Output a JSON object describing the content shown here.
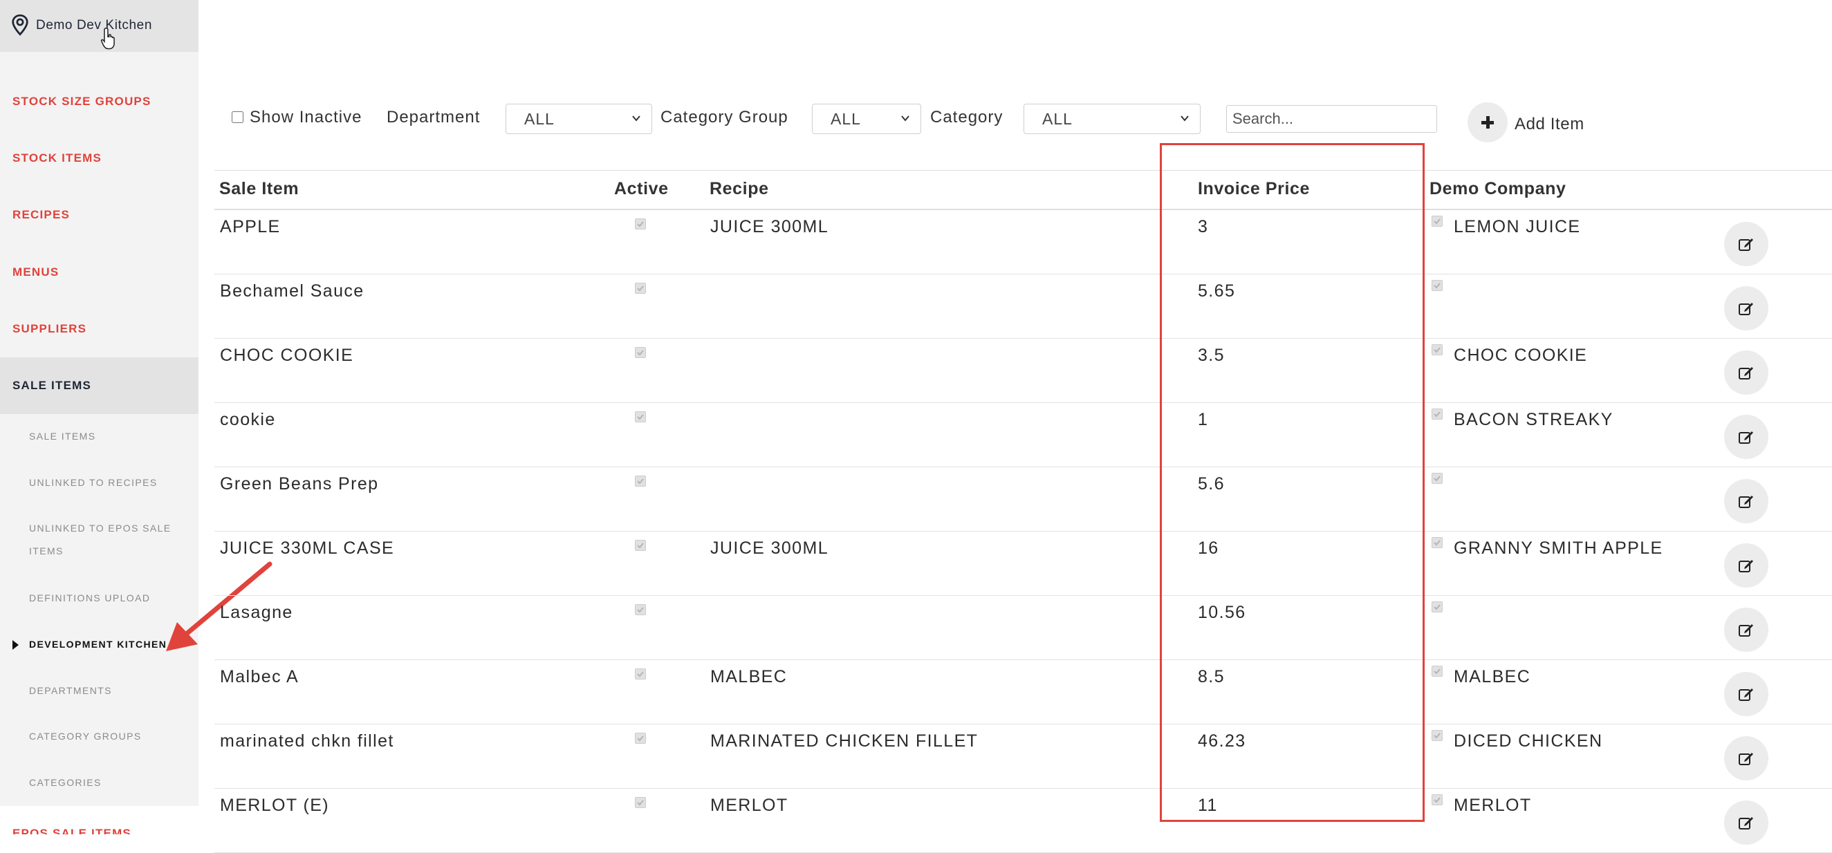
{
  "sidebar": {
    "location": "Demo Dev Kitchen",
    "nav": [
      {
        "label": "STOCK SIZE GROUPS"
      },
      {
        "label": "STOCK ITEMS"
      },
      {
        "label": "RECIPES"
      },
      {
        "label": "MENUS"
      },
      {
        "label": "SUPPLIERS"
      },
      {
        "label": "SALE ITEMS"
      }
    ],
    "sub": [
      {
        "label": "SALE ITEMS"
      },
      {
        "label": "UNLINKED TO RECIPES"
      },
      {
        "label_line1": "UNLINKED TO EPOS SALE",
        "label_line2": "ITEMS"
      },
      {
        "label": "DEFINITIONS UPLOAD"
      },
      {
        "label": "DEVELOPMENT KITCHEN"
      },
      {
        "label": "DEPARTMENTS"
      },
      {
        "label": "CATEGORY GROUPS"
      },
      {
        "label": "CATEGORIES"
      }
    ],
    "bottom": "EPOS SALE ITEMS"
  },
  "filters": {
    "show_inactive": "Show Inactive",
    "department_label": "Department",
    "department_value": "ALL",
    "category_group_label": "Category Group",
    "category_group_value": "ALL",
    "category_label": "Category",
    "category_value": "ALL",
    "search_placeholder": "Search...",
    "add_item": "Add Item"
  },
  "table": {
    "headers": {
      "sale_item": "Sale Item",
      "active": "Active",
      "recipe": "Recipe",
      "invoice_price": "Invoice Price",
      "company": "Demo Company"
    },
    "rows": [
      {
        "name": "APPLE",
        "recipe": "JUICE 300ML",
        "price": "3",
        "company_item": "LEMON JUICE"
      },
      {
        "name": "Bechamel Sauce",
        "recipe": "",
        "price": "5.65",
        "company_item": ""
      },
      {
        "name": "CHOC COOKIE",
        "recipe": "",
        "price": "3.5",
        "company_item": "CHOC COOKIE"
      },
      {
        "name": "cookie",
        "recipe": "",
        "price": "1",
        "company_item": "BACON STREAKY"
      },
      {
        "name": "Green Beans Prep",
        "recipe": "",
        "price": "5.6",
        "company_item": ""
      },
      {
        "name": "JUICE 330ML CASE",
        "recipe": "JUICE 300ML",
        "price": "16",
        "company_item": "GRANNY SMITH APPLE"
      },
      {
        "name": "Lasagne",
        "recipe": "",
        "price": "10.56",
        "company_item": ""
      },
      {
        "name": "Malbec A",
        "recipe": "MALBEC",
        "price": "8.5",
        "company_item": "MALBEC"
      },
      {
        "name": "marinated chkn fillet",
        "recipe": "MARINATED CHICKEN FILLET",
        "price": "46.23",
        "company_item": "DICED CHICKEN"
      },
      {
        "name": "MERLOT (E)",
        "recipe": "MERLOT",
        "price": "11",
        "company_item": "MERLOT"
      }
    ]
  },
  "colors": {
    "accent_red": "#e0423b",
    "nav_dark": "#1d2535",
    "highlight_border": "#e0433c"
  }
}
